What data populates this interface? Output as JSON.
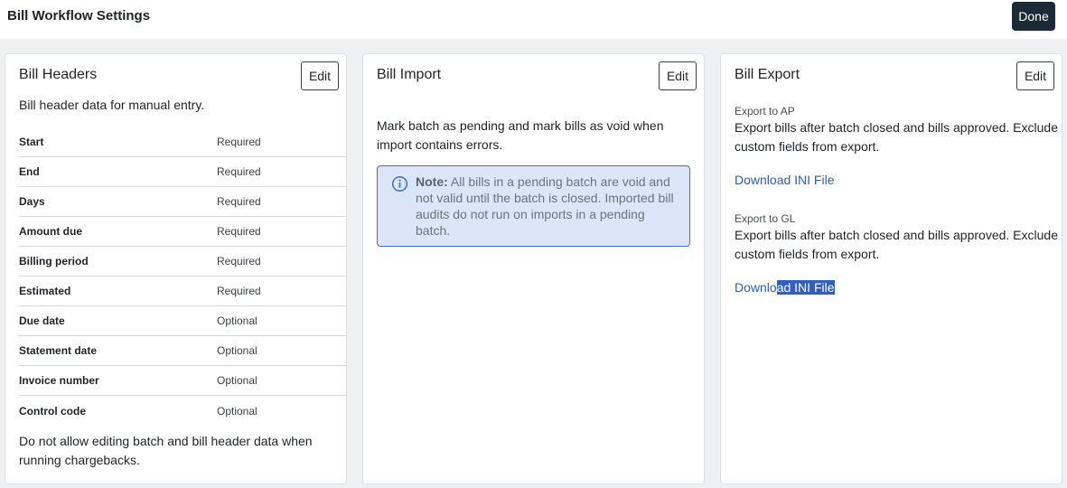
{
  "header": {
    "title": "Bill Workflow Settings",
    "done_label": "Done"
  },
  "bill_headers": {
    "title": "Bill Headers",
    "edit_label": "Edit",
    "description": "Bill header data for manual entry.",
    "fields": [
      {
        "name": "Start",
        "status": "Required"
      },
      {
        "name": "End",
        "status": "Required"
      },
      {
        "name": "Days",
        "status": "Required"
      },
      {
        "name": "Amount due",
        "status": "Required"
      },
      {
        "name": "Billing period",
        "status": "Required"
      },
      {
        "name": "Estimated",
        "status": "Required"
      },
      {
        "name": "Due date",
        "status": "Optional"
      },
      {
        "name": "Statement date",
        "status": "Optional"
      },
      {
        "name": "Invoice number",
        "status": "Optional"
      },
      {
        "name": "Control code",
        "status": "Optional"
      }
    ],
    "footer": "Do not allow editing batch and bill header data when running chargebacks."
  },
  "bill_import": {
    "title": "Bill Import",
    "edit_label": "Edit",
    "description": "Mark batch as pending and mark bills as void when import contains errors.",
    "note_label": "Note:",
    "note_text": "All bills in a pending batch are void and not valid until the batch is closed. Imported bill audits do not run on imports in a pending batch.",
    "note_icon": "info-icon"
  },
  "bill_export": {
    "title": "Bill Export",
    "edit_label": "Edit",
    "ap": {
      "label": "Export to AP",
      "description": "Export bills after batch closed and bills approved. Exclude custom fields from export.",
      "link": "Download INI File"
    },
    "gl": {
      "label": "Export to GL",
      "description": "Export bills after batch closed and bills approved. Exclude custom fields from export.",
      "link_part1": "Downlo",
      "link_part2": "ad INI File"
    }
  },
  "colors": {
    "accent": "#1b2a36",
    "link": "#2f5fb0",
    "note_bg": "#dbe6fa",
    "note_border": "#3f6fc6"
  }
}
